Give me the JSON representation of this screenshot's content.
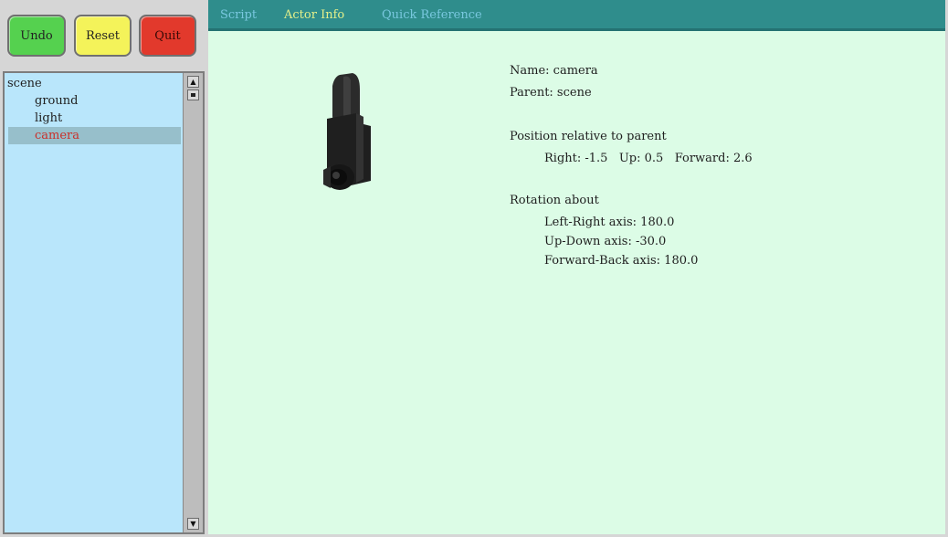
{
  "controls": {
    "undo_label": "Undo",
    "reset_label": "Reset",
    "quit_label": "Quit"
  },
  "scene_tree": {
    "items": [
      {
        "label": "scene",
        "level": 0,
        "selected": false
      },
      {
        "label": "ground",
        "level": 1,
        "selected": false
      },
      {
        "label": "light",
        "level": 1,
        "selected": false
      },
      {
        "label": "camera",
        "level": 1,
        "selected": true
      }
    ]
  },
  "tabs": {
    "script": "Script",
    "actor_info": "Actor Info",
    "quick_reference": "Quick Reference",
    "active": "Actor Info"
  },
  "actor_info": {
    "name_line": "Name: camera",
    "parent_line": "Parent: scene",
    "position_heading": "Position relative to parent",
    "position_values": "Right: -1.5   Up: 0.5   Forward: 2.6",
    "rotation_heading": "Rotation about",
    "rotation_lr": "Left-Right axis: 180.0",
    "rotation_ud": "Up-Down axis: -30.0",
    "rotation_fb": "Forward-Back axis: 180.0"
  },
  "colors": {
    "undo": "#55d14f",
    "reset": "#f4f35a",
    "quit": "#e2392c",
    "tab_bar": "#2f8d8c",
    "active_tab_text": "#e4f08a",
    "main_bg": "#dcfce6",
    "tree_bg": "#b9e6fb",
    "selected_text": "#c9302a"
  },
  "icons": {
    "scroll_up": "scroll-up-arrow-icon",
    "scroll_down": "scroll-down-arrow-icon",
    "camera_preview": "camera-model-icon"
  }
}
